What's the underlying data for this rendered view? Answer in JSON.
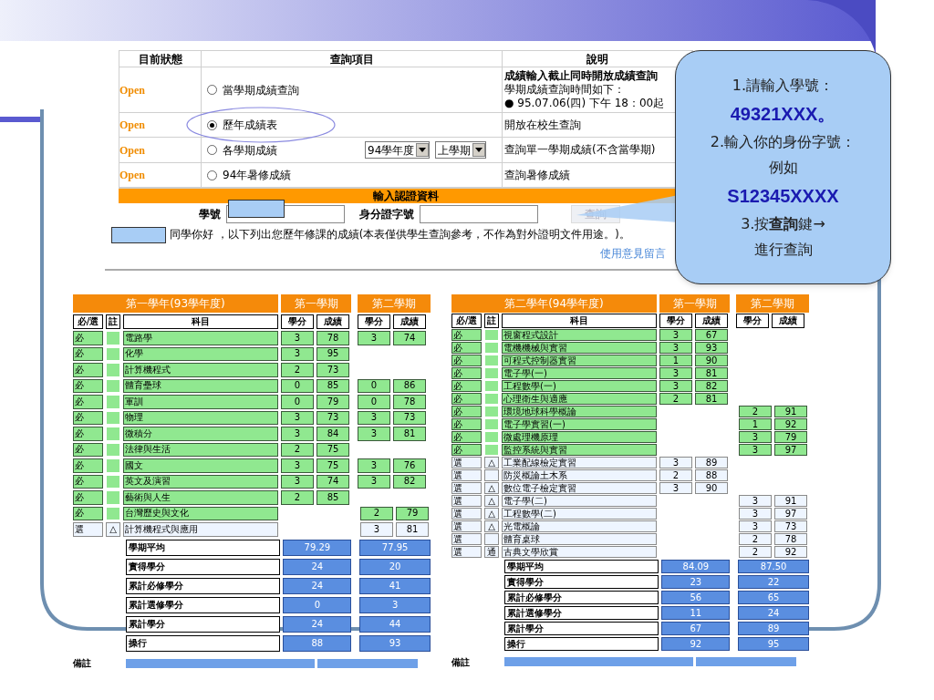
{
  "query": {
    "headers": [
      "目前狀態",
      "查詢項目",
      "說明"
    ],
    "rows": [
      {
        "status": "Open",
        "option": "當學期成績查詢",
        "selected": false,
        "description": [
          {
            "text": "成績輸入截止同時開放成績查詢",
            "bold": true
          },
          {
            "text": "學期成績查詢時間如下：",
            "bold": false
          },
          {
            "text": "● 95.07.06(四) 下午 18：00起",
            "bold": false
          }
        ]
      },
      {
        "status": "Open",
        "option": "歷年成績表",
        "selected": true,
        "description": [
          {
            "text": "開放在校生查詢",
            "bold": false
          }
        ]
      },
      {
        "status": "Open",
        "option": "各學期成績",
        "selected": false,
        "selects": [
          "94學年度",
          "上學期"
        ],
        "description": [
          {
            "text": "查詢單一學期成績(不含當學期)",
            "bold": false
          }
        ]
      },
      {
        "status": "Open",
        "option": "94年暑修成績",
        "selected": false,
        "description": [
          {
            "text": "查詢暑修成績",
            "bold": false
          }
        ]
      }
    ]
  },
  "auth": {
    "title": "輸入認證資料",
    "student_id_label": "學號",
    "id_label": "身分證字號",
    "submit": "查詢",
    "notice": "同學你好 ，以下列出您歷年修課的成績(本表僅供學生查詢參考，不作為對外證明文件用途。)。",
    "link": "使用意見留言"
  },
  "callout": [
    {
      "kind": "text",
      "text": "1.請輸入學號："
    },
    {
      "kind": "code",
      "text": "49321XXX。"
    },
    {
      "kind": "text",
      "text": "2.輸入你的身份字號："
    },
    {
      "kind": "text",
      "text": "例如"
    },
    {
      "kind": "code",
      "text": "S12345XXXX"
    },
    {
      "kind": "text",
      "text": "3.按**查詢**鍵→"
    },
    {
      "kind": "text",
      "text": "進行查詢"
    }
  ],
  "tables": [
    {
      "title": "第一學年(93學年度)",
      "semesters": [
        "第一學期",
        "第二學期"
      ],
      "columns": [
        "必/選",
        "註",
        "科目",
        "學分",
        "成績",
        "學分",
        "成績"
      ],
      "courses": [
        {
          "kind": "required",
          "type": "必",
          "name": "電路學",
          "s1": [
            "3",
            "78"
          ],
          "s2": [
            "3",
            "74"
          ]
        },
        {
          "kind": "required",
          "type": "必",
          "name": "化學",
          "s1": [
            "3",
            "95"
          ]
        },
        {
          "kind": "required",
          "type": "必",
          "name": "計算機程式",
          "s1": [
            "2",
            "73"
          ]
        },
        {
          "kind": "required",
          "type": "必",
          "name": "體育壘球",
          "s1": [
            "0",
            "85"
          ],
          "s2": [
            "0",
            "86"
          ]
        },
        {
          "kind": "required",
          "type": "必",
          "name": "軍訓",
          "s1": [
            "0",
            "79"
          ],
          "s2": [
            "0",
            "78"
          ]
        },
        {
          "kind": "required",
          "type": "必",
          "name": "物理",
          "s1": [
            "3",
            "73"
          ],
          "s2": [
            "3",
            "73"
          ]
        },
        {
          "kind": "required",
          "type": "必",
          "name": "微積分",
          "s1": [
            "3",
            "84"
          ],
          "s2": [
            "3",
            "81"
          ]
        },
        {
          "kind": "required",
          "type": "必",
          "name": "法律與生活",
          "s1": [
            "2",
            "75"
          ]
        },
        {
          "kind": "required",
          "type": "必",
          "name": "國文",
          "s1": [
            "3",
            "75"
          ],
          "s2": [
            "3",
            "76"
          ]
        },
        {
          "kind": "required",
          "type": "必",
          "name": "英文及演習",
          "s1": [
            "3",
            "74"
          ],
          "s2": [
            "3",
            "82"
          ]
        },
        {
          "kind": "required",
          "type": "必",
          "name": "藝術與人生",
          "s1": [
            "2",
            "85"
          ]
        },
        {
          "kind": "required",
          "type": "必",
          "name": "台灣歷史與文化",
          "s2": [
            "2",
            "79"
          ]
        },
        {
          "kind": "elective",
          "type": "選",
          "note": "△",
          "name": "計算機程式與應用",
          "s2": [
            "3",
            "81"
          ]
        }
      ],
      "summary": [
        {
          "label": "學期平均",
          "values": [
            "79.29",
            "77.95"
          ]
        },
        {
          "label": "實得學分",
          "values": [
            "24",
            "20"
          ]
        },
        {
          "label": "累計必修學分",
          "values": [
            "24",
            "41"
          ]
        },
        {
          "label": "累計選修學分",
          "values": [
            "0",
            "3"
          ]
        },
        {
          "label": "累計學分",
          "values": [
            "24",
            "44"
          ]
        },
        {
          "label": "操行",
          "values": [
            "88",
            "93"
          ]
        }
      ],
      "remarks_label": "備註"
    },
    {
      "title": "第二學年(94學年度)",
      "semesters": [
        "第一學期",
        "第二學期"
      ],
      "columns": [
        "必/選",
        "註",
        "科目",
        "學分",
        "成績",
        "學分",
        "成績"
      ],
      "courses": [
        {
          "kind": "required",
          "type": "必",
          "name": "視窗程式設計",
          "s1": [
            "3",
            "67"
          ]
        },
        {
          "kind": "required",
          "type": "必",
          "name": "電機機械與實習",
          "s1": [
            "3",
            "93"
          ]
        },
        {
          "kind": "required",
          "type": "必",
          "name": "可程式控制器實習",
          "s1": [
            "1",
            "90"
          ]
        },
        {
          "kind": "required",
          "type": "必",
          "name": "電子學(一)",
          "s1": [
            "3",
            "81"
          ]
        },
        {
          "kind": "required",
          "type": "必",
          "name": "工程數學(一)",
          "s1": [
            "3",
            "82"
          ]
        },
        {
          "kind": "required",
          "type": "必",
          "name": "心理衛生與適應",
          "s1": [
            "2",
            "81"
          ]
        },
        {
          "kind": "required",
          "type": "必",
          "name": "環境地球科學概論",
          "s2": [
            "2",
            "91"
          ]
        },
        {
          "kind": "required",
          "type": "必",
          "name": "電子學實習(一)",
          "s2": [
            "1",
            "92"
          ]
        },
        {
          "kind": "required",
          "type": "必",
          "name": "微處理機原理",
          "s2": [
            "3",
            "79"
          ]
        },
        {
          "kind": "required",
          "type": "必",
          "name": "監控系統與實習",
          "s2": [
            "3",
            "97"
          ]
        },
        {
          "kind": "elective",
          "type": "選",
          "note": "△",
          "name": "工業配線檢定實習",
          "s1": [
            "3",
            "89"
          ]
        },
        {
          "kind": "elective",
          "type": "選",
          "name": "防災概論土木系",
          "s1": [
            "2",
            "88"
          ]
        },
        {
          "kind": "elective",
          "type": "選",
          "note": "△",
          "name": "數位電子檢定實習",
          "s1": [
            "3",
            "90"
          ]
        },
        {
          "kind": "elective",
          "type": "選",
          "note": "△",
          "name": "電子學(二)",
          "s2": [
            "3",
            "91"
          ]
        },
        {
          "kind": "elective",
          "type": "選",
          "note": "△",
          "name": "工程數學(二)",
          "s2": [
            "3",
            "97"
          ]
        },
        {
          "kind": "elective",
          "type": "選",
          "note": "△",
          "name": "光電概論",
          "s2": [
            "3",
            "73"
          ]
        },
        {
          "kind": "elective",
          "type": "選",
          "name": "體育桌球",
          "s2": [
            "2",
            "78"
          ]
        },
        {
          "kind": "elective",
          "type": "選",
          "note": "通",
          "name": "古典文學欣賞",
          "s2": [
            "2",
            "92"
          ]
        }
      ],
      "summary": [
        {
          "label": "學期平均",
          "values": [
            "84.09",
            "87.50"
          ]
        },
        {
          "label": "實得學分",
          "values": [
            "23",
            "22"
          ]
        },
        {
          "label": "累計必修學分",
          "values": [
            "56",
            "65"
          ]
        },
        {
          "label": "累計選修學分",
          "values": [
            "11",
            "24"
          ]
        },
        {
          "label": "累計學分",
          "values": [
            "67",
            "89"
          ]
        },
        {
          "label": "操行",
          "values": [
            "92",
            "95"
          ]
        }
      ],
      "remarks_label": "備註"
    }
  ]
}
